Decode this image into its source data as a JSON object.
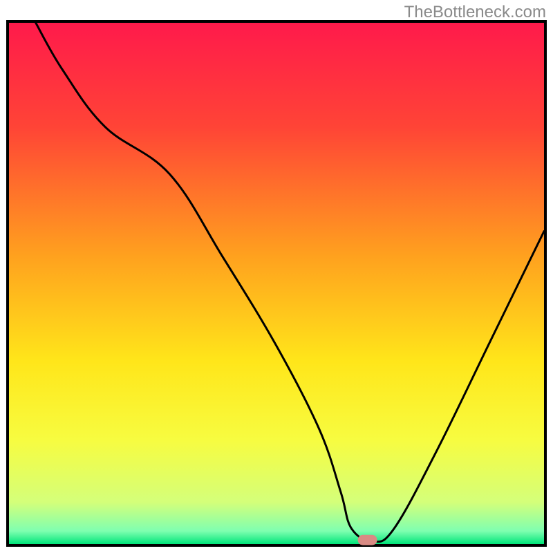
{
  "watermark": "TheBottleneck.com",
  "chart_data": {
    "type": "line",
    "title": "",
    "xlabel": "",
    "ylabel": "",
    "xlim": [
      0,
      100
    ],
    "ylim": [
      0,
      100
    ],
    "grid": false,
    "legend": false,
    "gradient_stops": [
      {
        "offset": 0,
        "color": "#ff1a4b"
      },
      {
        "offset": 0.2,
        "color": "#ff4436"
      },
      {
        "offset": 0.45,
        "color": "#ffa21e"
      },
      {
        "offset": 0.65,
        "color": "#ffe61a"
      },
      {
        "offset": 0.8,
        "color": "#f7fc40"
      },
      {
        "offset": 0.92,
        "color": "#d4ff7a"
      },
      {
        "offset": 0.975,
        "color": "#7fffb0"
      },
      {
        "offset": 1.0,
        "color": "#00e57a"
      }
    ],
    "marker": {
      "x": 67,
      "y": 0.7,
      "color": "#d98b84"
    },
    "series": [
      {
        "name": "bottleneck-curve",
        "x": [
          5,
          10,
          18,
          30,
          40,
          50,
          58,
          62,
          64,
          68,
          72,
          80,
          90,
          100
        ],
        "y": [
          100,
          91,
          80,
          71,
          55,
          38,
          22,
          10,
          3,
          0.5,
          3,
          18,
          39,
          60
        ]
      }
    ]
  }
}
